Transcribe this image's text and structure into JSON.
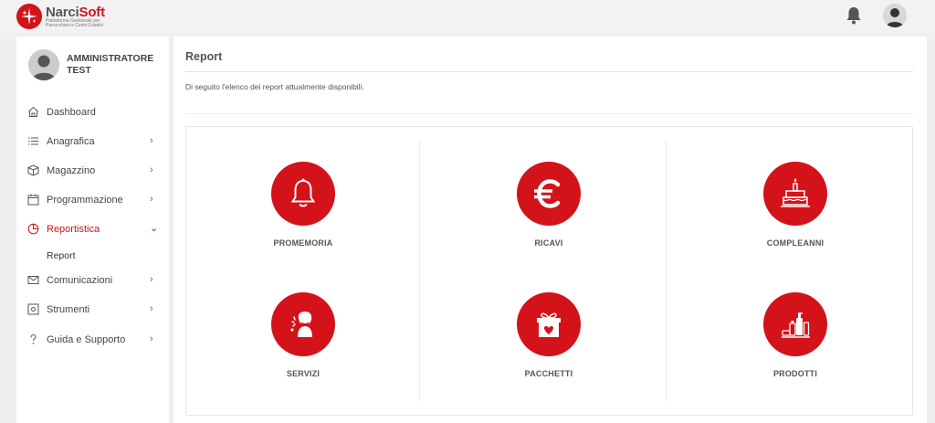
{
  "app": {
    "logo_name_part1": "Narci",
    "logo_name_part2": "Soft",
    "logo_tagline": "Piattaforma Gestionale per Parrucchieri e Centri Estetici"
  },
  "topbar": {
    "bell_icon": "bell-icon",
    "avatar_icon": "user-avatar-icon"
  },
  "user": {
    "name": "AMMINISTRATORE TEST"
  },
  "sidebar": {
    "items": [
      {
        "label": "Dashboard",
        "icon": "home-icon",
        "chevron": ""
      },
      {
        "label": "Anagrafica",
        "icon": "list-icon",
        "chevron": "›"
      },
      {
        "label": "Magazzino",
        "icon": "box-icon",
        "chevron": "›"
      },
      {
        "label": "Programmazione",
        "icon": "calendar-icon",
        "chevron": "›"
      },
      {
        "label": "Reportistica",
        "icon": "pie-chart-icon",
        "chevron": "⌄"
      },
      {
        "label": "Comunicazioni",
        "icon": "envelope-icon",
        "chevron": "›"
      },
      {
        "label": "Strumenti",
        "icon": "tools-icon",
        "chevron": "›"
      },
      {
        "label": "Guida e Supporto",
        "icon": "question-icon",
        "chevron": "›"
      }
    ],
    "sub_items": [
      {
        "label": "Report"
      }
    ]
  },
  "main": {
    "title": "Report",
    "description": "Di seguito l'elenco dei report attualmente disponibili."
  },
  "reports": [
    {
      "label": "PROMEMORIA",
      "icon": "bell-icon"
    },
    {
      "label": "RICAVI",
      "icon": "euro-icon"
    },
    {
      "label": "COMPLEANNI",
      "icon": "birthday-cake-icon"
    },
    {
      "label": "SERVIZI",
      "icon": "beauty-woman-icon"
    },
    {
      "label": "PACCHETTI",
      "icon": "gift-box-icon"
    },
    {
      "label": "PRODOTTI",
      "icon": "cosmetic-products-icon"
    }
  ],
  "colors": {
    "accent": "#d3121a",
    "background": "#efefef"
  }
}
